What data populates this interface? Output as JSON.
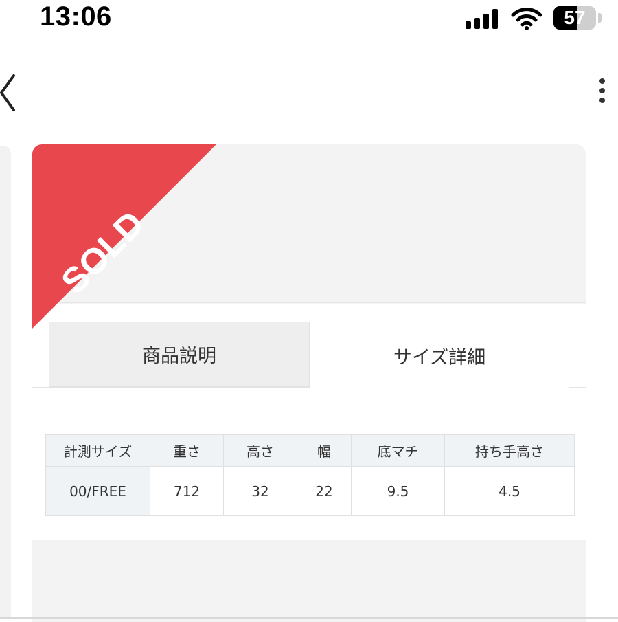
{
  "status_bar": {
    "time": "13:06",
    "battery": "57",
    "battery_level": 0.57,
    "icons": [
      "signal-icon",
      "wifi-icon",
      "battery-icon"
    ]
  },
  "nav": {
    "back_icon": "chevron-left-icon",
    "more_icon": "more-vertical-icon"
  },
  "product": {
    "sold_label": "SOLD",
    "sold_color": "#e8474e"
  },
  "tabs": [
    {
      "label": "商品説明",
      "active": false
    },
    {
      "label": "サイズ詳細",
      "active": true
    }
  ],
  "size_table": {
    "headers": [
      "計測サイズ",
      "重さ",
      "高さ",
      "幅",
      "底マチ",
      "持ち手高さ"
    ],
    "rows": [
      [
        "00/FREE",
        "712",
        "32",
        "22",
        "9.5",
        "4.5"
      ]
    ]
  }
}
